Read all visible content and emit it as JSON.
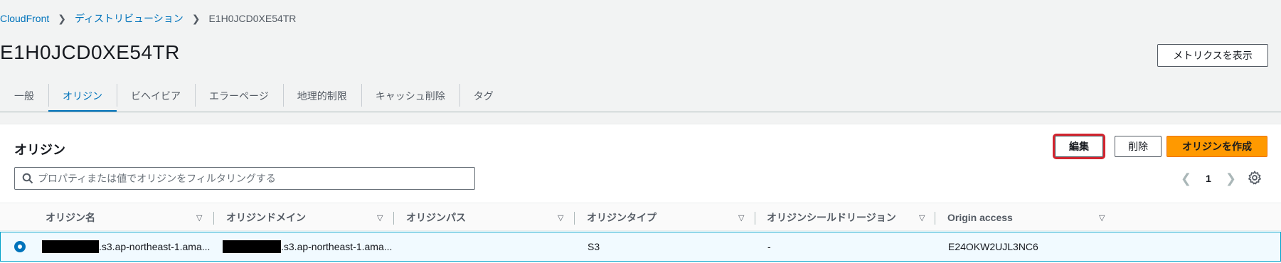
{
  "breadcrumb": {
    "root": "CloudFront",
    "distributions": "ディストリビューション",
    "current": "E1H0JCD0XE54TR"
  },
  "page": {
    "title": "E1H0JCD0XE54TR",
    "metrics_button": "メトリクスを表示"
  },
  "tabs": [
    {
      "label": "一般"
    },
    {
      "label": "オリジン",
      "active": true
    },
    {
      "label": "ビヘイビア"
    },
    {
      "label": "エラーページ"
    },
    {
      "label": "地理的制限"
    },
    {
      "label": "キャッシュ削除"
    },
    {
      "label": "タグ"
    }
  ],
  "origins": {
    "title": "オリジン",
    "edit_button": "編集",
    "delete_button": "削除",
    "create_button": "オリジンを作成",
    "search_placeholder": "プロパティまたは値でオリジンをフィルタリングする",
    "page_number": "1",
    "columns": [
      "オリジン名",
      "オリジンドメイン",
      "オリジンパス",
      "オリジンタイプ",
      "オリジンシールドリージョン",
      "Origin access"
    ],
    "rows": [
      {
        "selected": true,
        "origin_name": ".s3.ap-northeast-1.ama...",
        "origin_domain": ".s3.ap-northeast-1.ama...",
        "origin_path": "",
        "origin_type": "S3",
        "shield_region": "-",
        "origin_access": "E24OKW2UJL3NC6"
      }
    ]
  },
  "colors": {
    "link": "#0073bb",
    "primary": "#ff9900",
    "highlight": "#d1242f",
    "selected_row_border": "#00a1c9"
  }
}
